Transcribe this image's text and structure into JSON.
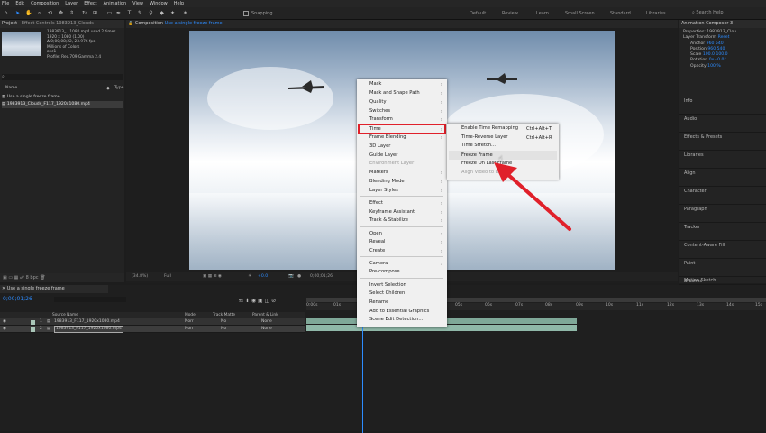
{
  "menubar": [
    "File",
    "Edit",
    "Composition",
    "Layer",
    "Effect",
    "Animation",
    "View",
    "Window",
    "Help"
  ],
  "toolbar": {
    "snapping": "Snapping",
    "workspaces": [
      "Default",
      "Review",
      "Learn",
      "Small Screen",
      "Standard",
      "Libraries"
    ],
    "search": "Search Help"
  },
  "project": {
    "tabs": [
      "Project",
      "Effect Controls 1983913_Clouds"
    ],
    "file_name": "1983913_...1080.mp4",
    "used": "used 2 times",
    "dims": "1920 x 1080 (1.00)",
    "duration": "Δ 0;00;08;22, 23.976 fps",
    "colors": "Millions of Colors",
    "codec": "avc1",
    "profile": "Profile: Rec.709 Gamma 2.4",
    "col_name": "Name",
    "col_type": "Type",
    "items": [
      "Use a single freeze frame",
      "1983913_Clouds_F117_1920x1080.mp4"
    ]
  },
  "comp": {
    "tab_prefix": "Composition",
    "tab_name": "Use a single freeze frame",
    "zoom": "(34.8%)",
    "quality": "Full",
    "exposure": "+0.0",
    "timecode": "0;00;01;26"
  },
  "context_menu": [
    {
      "label": "Mask",
      "sub": true
    },
    {
      "label": "Mask and Shape Path",
      "sub": true
    },
    {
      "label": "Quality",
      "sub": true
    },
    {
      "label": "Switches",
      "sub": true
    },
    {
      "label": "Transform",
      "sub": true
    },
    {
      "label": "Time",
      "sub": true
    },
    {
      "label": "Frame Blending",
      "sub": true
    },
    {
      "label": "3D Layer",
      "sub": false
    },
    {
      "label": "Guide Layer",
      "sub": false
    },
    {
      "label": "Environment Layer",
      "sub": false
    },
    {
      "label": "Markers",
      "sub": true
    },
    {
      "label": "Blending Mode",
      "sub": true
    },
    {
      "label": "Layer Styles",
      "sub": true
    },
    {
      "label": "Effect",
      "sub": true
    },
    {
      "label": "Keyframe Assistant",
      "sub": true
    },
    {
      "label": "Track & Stabilize",
      "sub": true
    },
    {
      "label": "Open",
      "sub": true
    },
    {
      "label": "Reveal",
      "sub": true
    },
    {
      "label": "Create",
      "sub": true
    },
    {
      "label": "Camera",
      "sub": true
    },
    {
      "label": "Pre-compose...",
      "sub": false
    },
    {
      "label": "Invert Selection",
      "sub": false
    },
    {
      "label": "Select Children",
      "sub": false
    },
    {
      "label": "Rename",
      "sub": false
    },
    {
      "label": "Add to Essential Graphics",
      "sub": false
    },
    {
      "label": "Scene Edit Detection...",
      "sub": false
    }
  ],
  "time_submenu": [
    {
      "label": "Enable Time Remapping",
      "shortcut": "Ctrl+Alt+T"
    },
    {
      "label": "Time-Reverse Layer",
      "shortcut": "Ctrl+Alt+R"
    },
    {
      "label": "Time Stretch...",
      "shortcut": ""
    },
    {
      "label": "Freeze Frame",
      "shortcut": ""
    },
    {
      "label": "Freeze On Last Frame",
      "shortcut": ""
    },
    {
      "label": "Align Video to Data",
      "shortcut": ""
    }
  ],
  "right_panel": {
    "title": "Animation Composer 3",
    "props": "Properties: 1983913_Clou",
    "layer_transform": "Layer Transform",
    "reset": "Reset",
    "transform": [
      {
        "label": "Anchor",
        "v1": "960",
        "v2": "540"
      },
      {
        "label": "Position",
        "v1": "960",
        "v2": "540"
      },
      {
        "label": "Scale",
        "v1": "100.0",
        "v2": "100.0"
      },
      {
        "label": "Rotation",
        "v1": "0x+0.0°",
        "v2": ""
      },
      {
        "label": "Opacity",
        "v1": "100 %",
        "v2": ""
      }
    ],
    "items": [
      "Info",
      "Audio",
      "Effects & Presets",
      "Libraries",
      "Align",
      "Character",
      "Paragraph",
      "Tracker",
      "Content-Aware Fill",
      "Paint",
      "Brushes",
      "Motion Sketch",
      "Smoother",
      "Wiggler",
      "Mask Interpolation"
    ]
  },
  "timeline": {
    "tab": "Use a single freeze frame",
    "timecode": "0;00;01;26",
    "cols": {
      "source": "Source Name",
      "mode": "Mode",
      "trkmat": "Track Matte",
      "parent": "Parent & Link"
    },
    "layers": [
      {
        "num": "1",
        "name": "1983913_F117_1920x1080.mp4",
        "mode": "Norr",
        "matte": "No",
        "parent": "None"
      },
      {
        "num": "2",
        "name": "1983913_F117_1920x1080.mp4",
        "mode": "Norr",
        "matte": "No",
        "parent": "None"
      }
    ],
    "ruler": [
      "0:00s",
      "01s",
      "02s",
      "03s",
      "04s",
      "05s",
      "06s",
      "07s",
      "08s",
      "09s",
      "10s",
      "11s",
      "12s",
      "13s",
      "14s",
      "15s"
    ]
  },
  "accent": "#2d8cff",
  "highlight": "#e0202a"
}
